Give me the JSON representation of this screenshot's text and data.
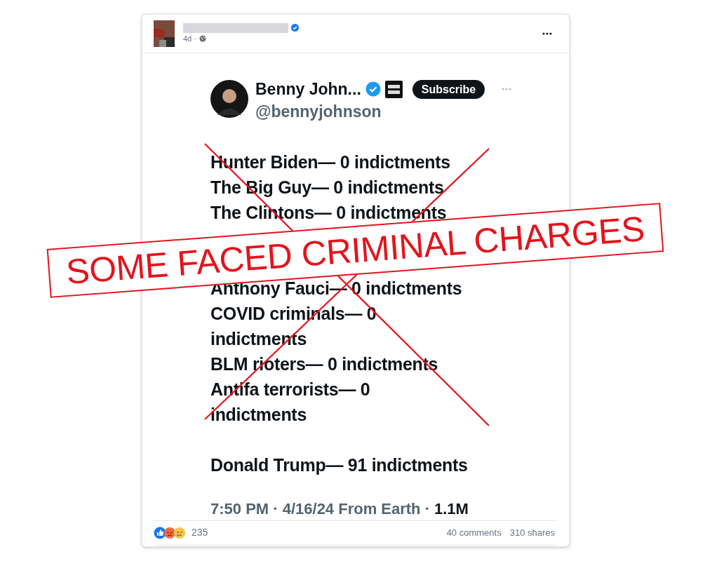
{
  "post": {
    "time": "4d ·",
    "tweet": {
      "author": "Benny John...",
      "handle": "@bennyjohnson",
      "subscribe": "Subscribe",
      "lines_above_stamp": [
        "Hunter Biden— 0 indictments",
        "The Big Guy— 0 indictments",
        "The Clintons— 0 indictments"
      ],
      "lines_below_stamp": [
        "Anthony Fauci— 0 indictments",
        "COVID criminals— 0",
        "indictments",
        "BLM rioters— 0 indictments",
        "Antifa terrorists— 0",
        "indictments"
      ],
      "final_line": "Donald Trump— 91 indictments",
      "meta": "7:50 PM · 4/16/24 From Earth ·",
      "views": "1.1M"
    },
    "reactions": {
      "count": "235",
      "comments": "40 comments",
      "shares": "310 shares"
    }
  },
  "overlay": {
    "stamp": "SOME FACED CRIMINAL CHARGES"
  }
}
